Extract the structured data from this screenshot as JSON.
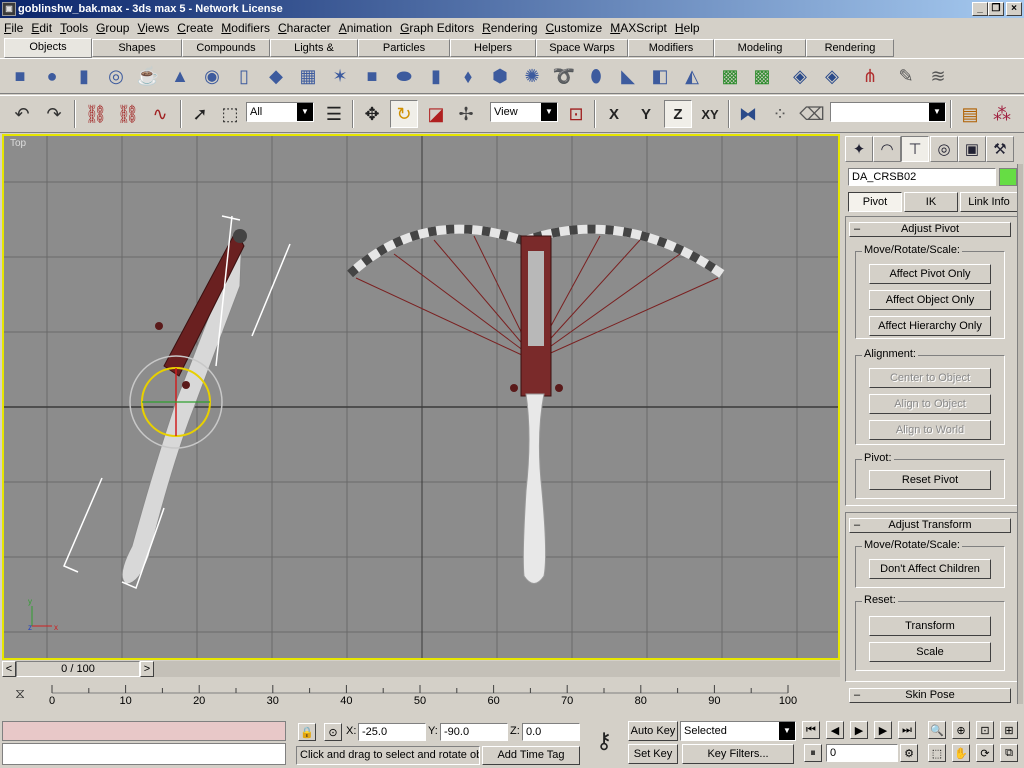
{
  "window": {
    "title": "goblinshw_bak.max - 3ds max 5 - Network License",
    "icon": "3ds-max-icon"
  },
  "menubar": [
    "File",
    "Edit",
    "Tools",
    "Group",
    "Views",
    "Create",
    "Modifiers",
    "Character",
    "Animation",
    "Graph Editors",
    "Rendering",
    "Customize",
    "MAXScript",
    "Help"
  ],
  "command_tabs": [
    "Objects",
    "Shapes",
    "Compounds",
    "Lights & Cameras",
    "Particles",
    "Helpers",
    "Space Warps",
    "Modifiers",
    "Modeling",
    "Rendering"
  ],
  "main_toolbar": {
    "selection_filter": "All",
    "reference_coord": "View",
    "axis_x": "X",
    "axis_y": "Y",
    "axis_z": "Z",
    "axis_xy": "XY",
    "named_selection": ""
  },
  "viewport": {
    "label": "Top",
    "axis_y": "y",
    "axis_z": "z",
    "axis_x": "x"
  },
  "command_panel": {
    "object_name": "DA_CRSB02",
    "object_color": "#66dd44",
    "tabs": [
      "Pivot",
      "IK",
      "Link Info"
    ],
    "adjust_pivot": {
      "title": "Adjust Pivot",
      "move_group": "Move/Rotate/Scale:",
      "affect_pivot": "Affect Pivot Only",
      "affect_object": "Affect Object Only",
      "affect_hierarchy": "Affect Hierarchy Only",
      "alignment_group": "Alignment:",
      "center_to_object": "Center to Object",
      "align_to_object": "Align to Object",
      "align_to_world": "Align to World",
      "pivot_group": "Pivot:",
      "reset_pivot": "Reset Pivot"
    },
    "adjust_transform": {
      "title": "Adjust Transform",
      "move_group": "Move/Rotate/Scale:",
      "dont_affect_children": "Don't Affect Children",
      "reset_group": "Reset:",
      "transform": "Transform",
      "scale": "Scale"
    },
    "skin_pose": {
      "title": "Skin Pose"
    }
  },
  "time_slider": {
    "label": "0 / 100",
    "prev": "<",
    "next": ">"
  },
  "track": {
    "ticks": [
      "0",
      "10",
      "20",
      "30",
      "40",
      "50",
      "60",
      "70",
      "80",
      "90",
      "100"
    ]
  },
  "status": {
    "x_label": "X:",
    "x_value": "-25.0",
    "y_label": "Y:",
    "y_value": "-90.0",
    "z_label": "Z:",
    "z_value": "0.0",
    "prompt": "Click and drag to select and rotate ob",
    "add_time_tag": "Add Time Tag",
    "auto_key": "Auto Key",
    "set_key": "Set Key",
    "key_mode": "Selected",
    "key_filters": "Key Filters...",
    "frame": "0"
  }
}
